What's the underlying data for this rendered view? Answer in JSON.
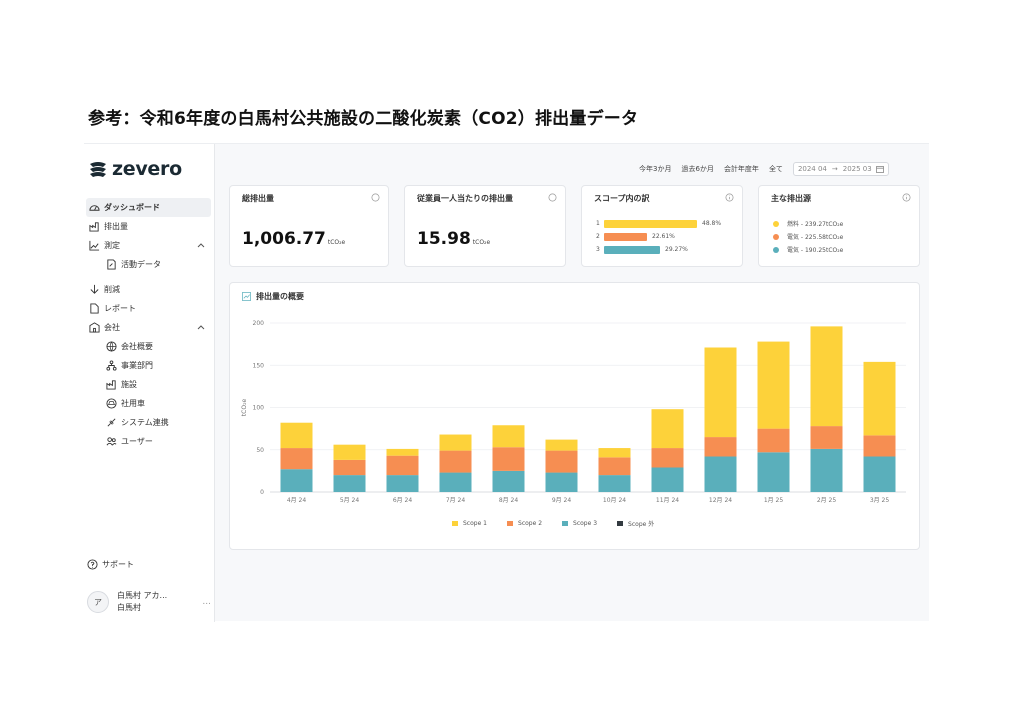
{
  "page_heading": "参考：令和6年度の白馬村公共施設の二酸化炭素（CO2）排出量データ",
  "app": {
    "logo_text": "zevero",
    "nav": {
      "dashboard": "ダッシュボード",
      "emissions": "排出量",
      "measurement": "測定",
      "activity_data": "活動データ",
      "reduction": "削減",
      "reports": "レポート",
      "company": "会社",
      "company_overview": "会社概要",
      "business_units": "事業部門",
      "facilities": "施設",
      "vehicles": "社用車",
      "integrations": "システム連携",
      "users": "ユーザー"
    },
    "support": "サポート",
    "user": {
      "avatar_initial": "ア",
      "name": "白馬村 アカ...",
      "org": "白馬村",
      "more": "..."
    },
    "topbar": {
      "buttons": [
        "今年3か月",
        "過去6か月",
        "会計年度年",
        "全て"
      ],
      "date_start": "2024 04",
      "date_end": "2025 03"
    },
    "cards": {
      "total": {
        "title": "総排出量",
        "value": "1,006.77",
        "unit": "tCO₂e"
      },
      "per_employee": {
        "title": "従業員一人当たりの排出量",
        "value": "15.98",
        "unit": "tCO₂e"
      },
      "scope_breakdown": {
        "title": "スコープ内の訳",
        "rows": [
          {
            "num": "1",
            "pct": "48.8%",
            "fraction": 0.488,
            "color": "#fdd23a"
          },
          {
            "num": "2",
            "pct": "22.61%",
            "fraction": 0.226,
            "color": "#f68e52"
          },
          {
            "num": "3",
            "pct": "29.27%",
            "fraction": 0.293,
            "color": "#5aafbb"
          }
        ]
      },
      "sources": {
        "title": "主な排出源",
        "items": [
          {
            "label": "燃料 - 239.27tCO₂e",
            "color": "#fdd23a"
          },
          {
            "label": "電気 - 225.58tCO₂e",
            "color": "#f68e52"
          },
          {
            "label": "電気 - 190.25tCO₂e",
            "color": "#5aafbb"
          }
        ]
      }
    },
    "chart_card": {
      "title": "排出量の概要"
    }
  },
  "colors": {
    "scope1": "#fdd23a",
    "scope2": "#f68e52",
    "scope3": "#5aafbb",
    "scope_out": "#333a40"
  },
  "chart_data": {
    "type": "bar",
    "stacked": true,
    "title": "",
    "xlabel": "",
    "ylabel": "tCO₂e",
    "ylim": [
      0,
      200
    ],
    "yticks": [
      0,
      50,
      100,
      150,
      200
    ],
    "ytick_labels": [
      "0",
      "50",
      "100",
      "150",
      "200"
    ],
    "categories": [
      "4月 24",
      "5月 24",
      "6月 24",
      "7月 24",
      "8月 24",
      "9月 24",
      "10月 24",
      "11月 24",
      "12月 24",
      "1月 25",
      "2月 25",
      "3月 25"
    ],
    "series": [
      {
        "name": "Scope 3",
        "color": "#5aafbb",
        "values": [
          27,
          20,
          20,
          23,
          25,
          23,
          20,
          29,
          42,
          47,
          51,
          42
        ]
      },
      {
        "name": "Scope 2",
        "color": "#f68e52",
        "values": [
          25,
          18,
          23,
          26,
          28,
          26,
          21,
          23,
          23,
          28,
          27,
          25
        ]
      },
      {
        "name": "Scope 1",
        "color": "#fdd23a",
        "values": [
          30,
          18,
          8,
          19,
          26,
          13,
          11,
          46,
          106,
          103,
          118,
          87
        ]
      },
      {
        "name": "Scope 外",
        "color": "#333a40",
        "values": [
          0,
          0,
          0,
          0,
          0,
          0,
          0,
          0,
          0,
          0,
          0,
          0
        ]
      }
    ],
    "legend": [
      "Scope 1",
      "Scope 2",
      "Scope 3",
      "Scope 外"
    ],
    "legend_position": "bottom",
    "grid": true
  }
}
